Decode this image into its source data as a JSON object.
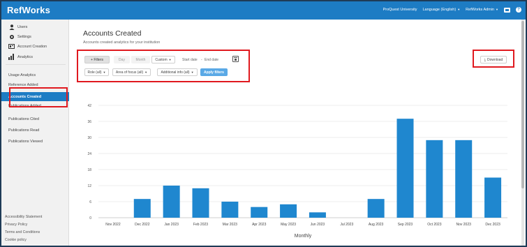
{
  "app": {
    "title": "RefWorks"
  },
  "topnav": {
    "university": "ProQuest University",
    "language": "Language (English)",
    "user": "RefWorks Admin"
  },
  "sidebar": {
    "items": [
      {
        "label": "Users",
        "icon": "user-icon"
      },
      {
        "label": "Settings",
        "icon": "gear-icon"
      },
      {
        "label": "Account Creation",
        "icon": "account-creation-icon"
      },
      {
        "label": "Analytics",
        "icon": "bar-chart-icon"
      },
      {
        "label": "Usage Analytics"
      },
      {
        "label": "Reference Added"
      },
      {
        "label": "Accounts Created"
      },
      {
        "label": "Publications Added"
      },
      {
        "label": "Publications Cited"
      },
      {
        "label": "Publications Read"
      },
      {
        "label": "Publications Viewed"
      }
    ],
    "footer": [
      "Accessibility Statement",
      "Privacy Policy",
      "Terms and Conditions",
      "Cookie policy"
    ]
  },
  "main": {
    "title": "Accounts Created",
    "subtitle": "Accounts created analytics for your institution",
    "filters": {
      "filters_label": "+ Filters",
      "day": "Day",
      "month": "Month",
      "custom": "Custom",
      "start_date": "Start date",
      "separator": "-",
      "end_date": "End date",
      "role": "Role (all)",
      "area": "Area of focus (all)",
      "additional": "Additional info (all)",
      "apply": "Apply filters"
    },
    "download_label": "Download"
  },
  "colors": {
    "brand": "#1d7cc4",
    "bar": "#1f87cf",
    "highlight": "#e0191f"
  },
  "chart_data": {
    "type": "bar",
    "categories": [
      "Nov 2022",
      "Dec 2022",
      "Jan 2023",
      "Feb 2023",
      "Mar 2023",
      "Apr 2023",
      "May 2023",
      "Jun 2023",
      "Jul 2023",
      "Aug 2023",
      "Sep 2023",
      "Oct 2023",
      "Nov 2023",
      "Dec 2023"
    ],
    "values": [
      0,
      7,
      12,
      11,
      6,
      4,
      5,
      2,
      0,
      7,
      37,
      29,
      29,
      15
    ],
    "xlabel": "Monthly",
    "ylabel": "",
    "ylim": [
      0,
      42
    ],
    "yticks": [
      0,
      6,
      12,
      18,
      24,
      30,
      36,
      42
    ],
    "grid": true
  }
}
